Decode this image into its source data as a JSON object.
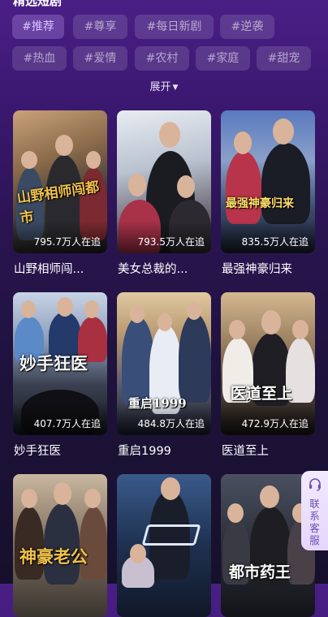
{
  "section": {
    "title": "精选短剧"
  },
  "tags_row1": [
    "#推荐",
    "#尊享",
    "#每日新剧",
    "#逆袭"
  ],
  "tags_row2": [
    "#热血",
    "#爱情",
    "#农村",
    "#家庭",
    "#甜宠"
  ],
  "expand_label": "展开",
  "dramas": [
    {
      "title": "山野相师闯...",
      "viewers": "795.7万人在追",
      "poster_text": "山野相师闯都市"
    },
    {
      "title": "美女总裁的...",
      "viewers": "793.5万人在追",
      "poster_text": ""
    },
    {
      "title": "最强神豪归来",
      "viewers": "835.5万人在追",
      "poster_text": "最强神豪归来"
    },
    {
      "title": "妙手狂医",
      "viewers": "407.7万人在追",
      "poster_text": "妙手狂医"
    },
    {
      "title": "重启1999",
      "viewers": "484.8万人在追",
      "poster_text": "重启1999"
    },
    {
      "title": "医道至上",
      "viewers": "472.9万人在追",
      "poster_text": "医道至上"
    },
    {
      "title": "",
      "viewers": "",
      "poster_text": "神豪老公"
    },
    {
      "title": "",
      "viewers": "",
      "poster_text": ""
    },
    {
      "title": "",
      "viewers": "",
      "poster_text": "都市药王"
    }
  ],
  "customer_service": {
    "label": "联系客服",
    "icon": "headset-icon"
  },
  "colors": {
    "accent_tag": "#d8c4ff",
    "background_top": "#4a1f86",
    "background_bottom": "#16102c",
    "service_text": "#6b4fb0"
  }
}
